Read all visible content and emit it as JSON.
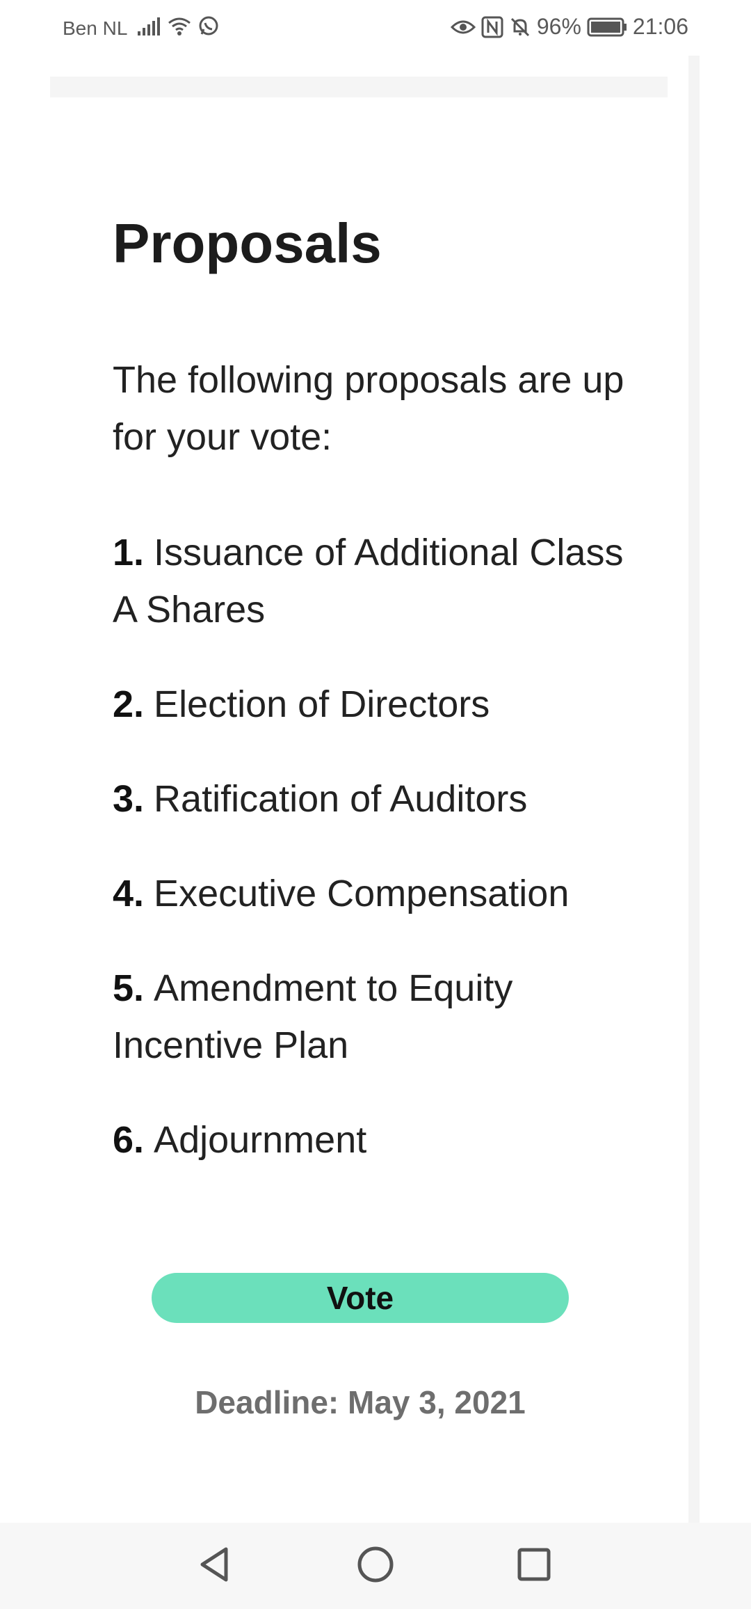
{
  "status_bar": {
    "carrier": "Ben NL",
    "battery": "96%",
    "time": "21:06"
  },
  "page": {
    "title": "Proposals",
    "intro": "The following proposals are up for your vote:",
    "proposals": [
      {
        "number": "1.",
        "label": "Issuance of Additional Class A Shares"
      },
      {
        "number": "2.",
        "label": "Election of Directors"
      },
      {
        "number": "3.",
        "label": "Ratification of Auditors"
      },
      {
        "number": "4.",
        "label": "Executive Compensation"
      },
      {
        "number": "5.",
        "label": "Amendment to Equity Incentive Plan"
      },
      {
        "number": "6.",
        "label": "Adjournment"
      }
    ],
    "vote_label": "Vote",
    "deadline": "Deadline: May 3, 2021"
  },
  "colors": {
    "vote_button": "#6be0bb",
    "deadline_text": "#6e6e6e"
  },
  "icons": {
    "status": [
      "signal-icon",
      "wifi-icon",
      "whatsapp-icon",
      "eye-icon",
      "nfc-icon",
      "mute-icon",
      "battery-icon"
    ],
    "nav": [
      "back-icon",
      "home-icon",
      "recents-icon"
    ]
  }
}
